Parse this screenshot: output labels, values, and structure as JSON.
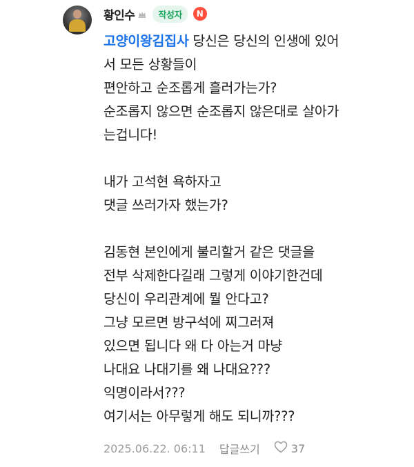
{
  "comment": {
    "author": "황인수",
    "writer_badge": "작성자",
    "new_badge": "N",
    "mention": "고양이왕김집사",
    "lines": [
      " 당신은 당신의 인생에 있어",
      "서 모든 상황들이",
      "편안하고 순조롭게 흘러가는가?",
      "순조롭지 않으면 순조롭지 않은대로 살아가",
      "는겁니다!",
      "",
      "내가 고석현 욕하자고",
      "댓글 쓰러가자 했는가?",
      "",
      "김동현 본인에게 불리할거 같은 댓글을",
      "전부 삭제한다길래 그렇게 이야기한건데",
      "당신이 우리관계에 뭘 안다고?",
      "그냥 모르면 방구석에 찌그러져",
      "있으면 됩니다 왜 다 아는거 마냥",
      "나대요 나대기를 왜 나대요???",
      "익명이라서???",
      "여기서는 아무렇게 해도 되니까???"
    ],
    "timestamp": "2025.06.22. 06:11",
    "reply_label": "답글쓰기",
    "like_count": "37",
    "colors": {
      "mention": "#1a73e8",
      "writer_badge_bg": "#e6f6ee",
      "writer_badge_text": "#1aa35b",
      "new_badge_bg": "#ff4e3b"
    },
    "icons": {
      "grade": "crown-icon",
      "like": "heart-outline-icon"
    }
  }
}
